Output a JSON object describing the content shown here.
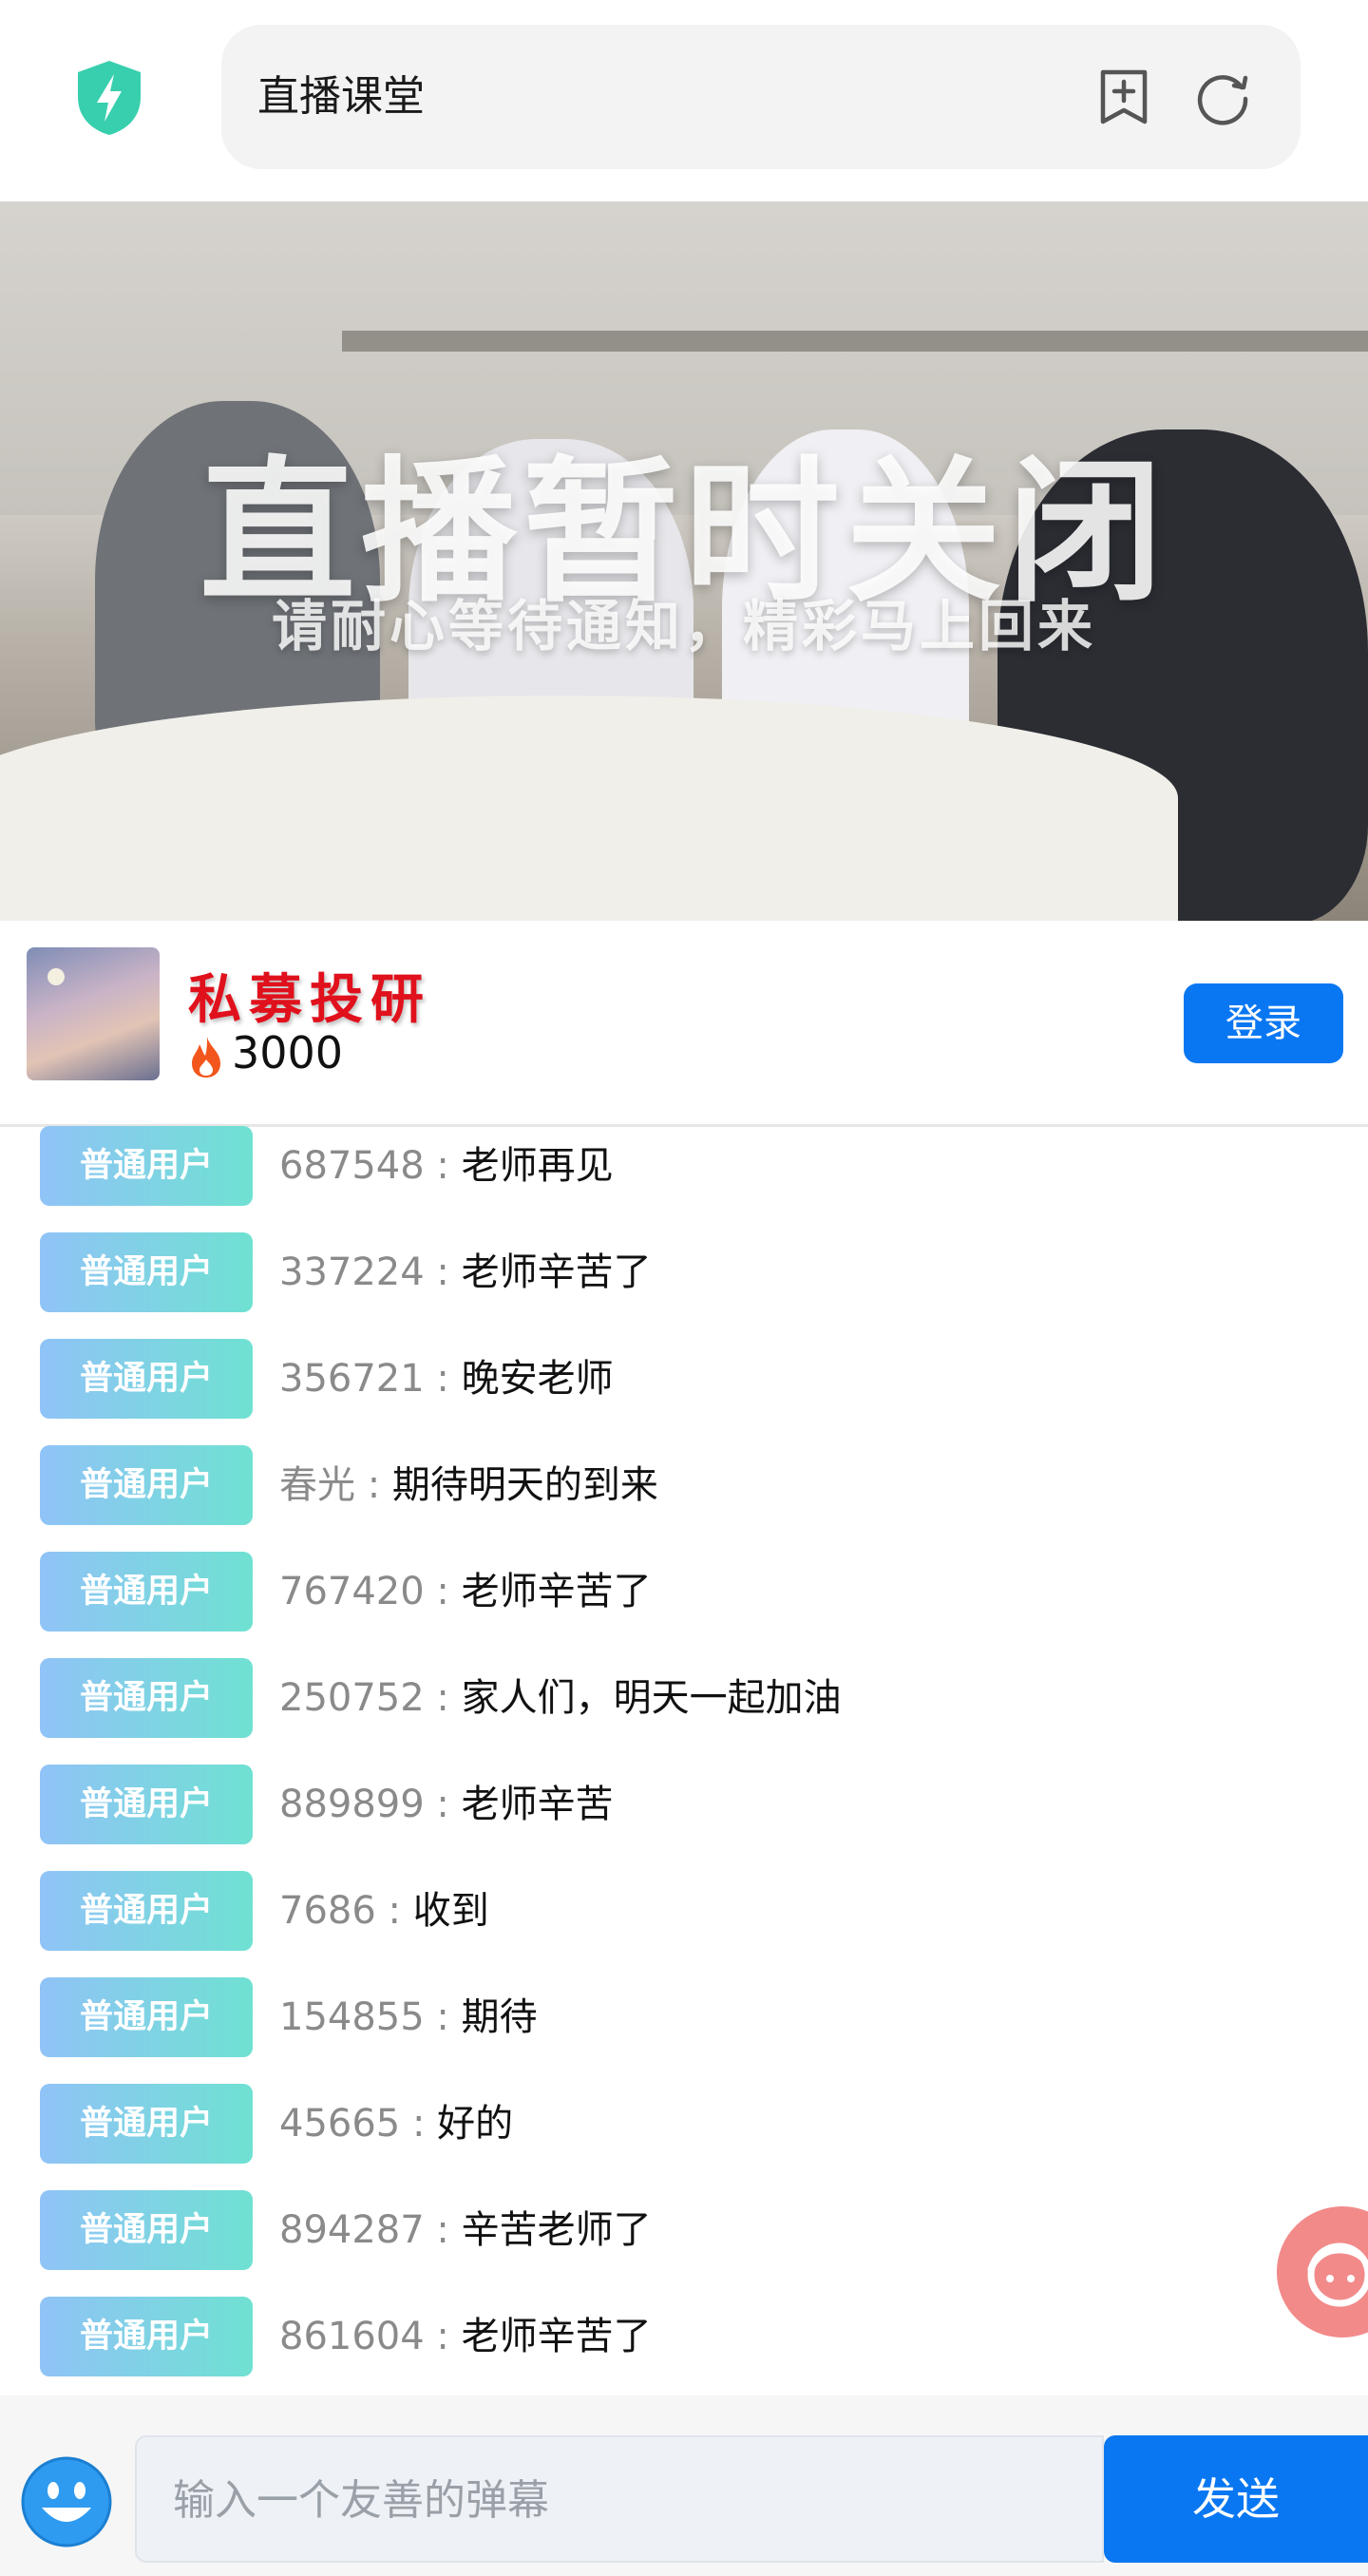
{
  "header": {
    "title": "直播课堂",
    "colors": {
      "shield": "#38cfae",
      "url_bg": "#f3f3f3"
    }
  },
  "video": {
    "overlay_title": "直播暂时关闭",
    "overlay_subtitle": "请耐心等待通知，精彩马上回来"
  },
  "channel": {
    "name": "私募投研",
    "heat": "3000",
    "login_label": "登录",
    "colors": {
      "name": "#e0111c",
      "login": "#0a77f2"
    }
  },
  "chat": {
    "badge_label": "普通用户",
    "messages": [
      {
        "user": "687548",
        "text": "老师再见"
      },
      {
        "user": "337224",
        "text": "老师辛苦了"
      },
      {
        "user": "356721",
        "text": "晚安老师"
      },
      {
        "user": "春光",
        "text": "期待明天的到来"
      },
      {
        "user": "767420",
        "text": "老师辛苦了"
      },
      {
        "user": "250752",
        "text": "家人们，明天一起加油"
      },
      {
        "user": "889899",
        "text": "老师辛苦"
      },
      {
        "user": "7686",
        "text": "收到"
      },
      {
        "user": "154855",
        "text": "期待"
      },
      {
        "user": "45665",
        "text": "好的"
      },
      {
        "user": "894287",
        "text": "辛苦老师了"
      },
      {
        "user": "861604",
        "text": "老师辛苦了"
      }
    ]
  },
  "composer": {
    "placeholder": "输入一个友善的弹幕",
    "value": "",
    "send_label": "发送"
  },
  "icons": [
    "shield-bolt-icon",
    "add-bookmark-icon",
    "refresh-icon",
    "fire-icon",
    "assistant-face-icon",
    "emoji-icon"
  ]
}
